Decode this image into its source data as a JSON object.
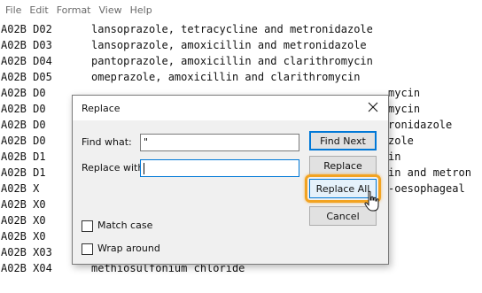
{
  "menu": {
    "file": "File",
    "edit": "Edit",
    "format": "Format",
    "view": "View",
    "help": "Help"
  },
  "editor": {
    "lines": [
      {
        "code": "A02B D02",
        "desc": "lansoprazole, tetracycline and metronidazole"
      },
      {
        "code": "A02B D03",
        "desc": "lansoprazole, amoxicillin and metronidazole"
      },
      {
        "code": "A02B D04",
        "desc": "pantoprazole, amoxicillin and clarithromycin"
      },
      {
        "code": "A02B D05",
        "desc": "omeprazole, amoxicillin and clarithromycin"
      },
      {
        "code": "A02B D0",
        "desc": "mycin"
      },
      {
        "code": "A02B D0",
        "desc": "mycin"
      },
      {
        "code": "A02B D0",
        "desc": "ronidazole"
      },
      {
        "code": "A02B D0",
        "desc": "zole"
      },
      {
        "code": "A02B D1",
        "desc": "in"
      },
      {
        "code": "A02B D1",
        "desc": "in and metron"
      },
      {
        "code": "A02B X",
        "desc": "-oesophageal"
      },
      {
        "code": "A02B X0",
        "desc": ""
      },
      {
        "code": "A02B X0",
        "desc": ""
      },
      {
        "code": "A02B X0",
        "desc": ""
      },
      {
        "code": "A02B X03",
        "desc": "pirenzepine"
      },
      {
        "code": "A02B X04",
        "desc": "methiosulfonium chloride"
      }
    ]
  },
  "dialog": {
    "title": "Replace",
    "find_label": "Find what:",
    "find_value": "\"",
    "replace_label": "Replace with:",
    "replace_value": "",
    "find_next": "Find Next",
    "replace": "Replace",
    "replace_all": "Replace All",
    "cancel": "Cancel",
    "match_case": "Match case",
    "wrap_around": "Wrap around",
    "match_case_checked": false,
    "wrap_around_checked": false
  },
  "colors": {
    "highlight": "#f2a321",
    "accent": "#0078d7"
  }
}
